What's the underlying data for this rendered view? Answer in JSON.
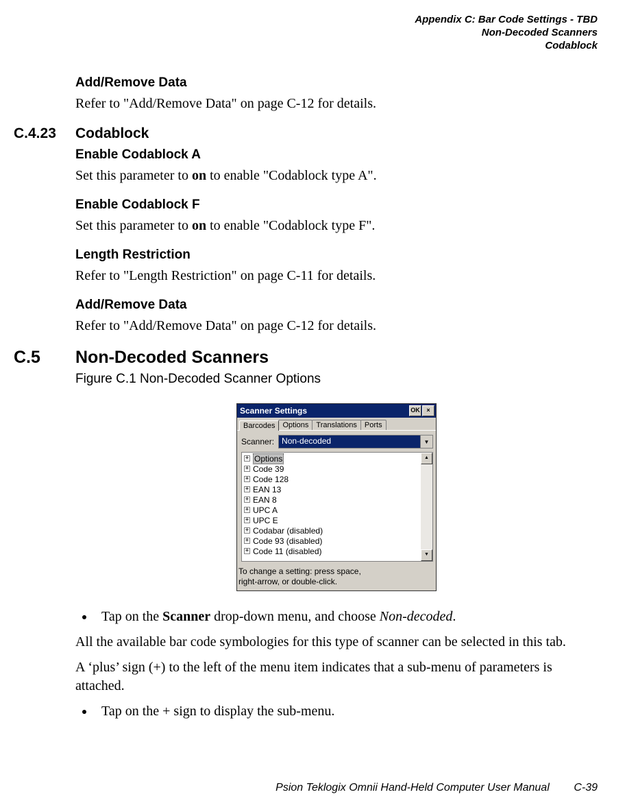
{
  "header": {
    "line1": "Appendix C:  Bar Code Settings - TBD",
    "line2": "Non-Decoded Scanners",
    "line3": "Codablock"
  },
  "sec_prev": {
    "add_remove_h": "Add/Remove Data",
    "add_remove_body": "Refer to \"Add/Remove Data\" on page C-12 for details."
  },
  "sec_c423": {
    "num": "C.4.23",
    "title": "Codablock",
    "enable_a_h": "Enable Codablock A",
    "enable_a_pre": "Set this parameter to ",
    "enable_a_bold": "on",
    "enable_a_post": " to enable \"Codablock type A\".",
    "enable_f_h": "Enable Codablock F",
    "enable_f_pre": "Set this parameter to ",
    "enable_f_bold": "on",
    "enable_f_post": " to enable \"Codablock type F\".",
    "length_h": "Length Restriction",
    "length_body": "Refer to \"Length Restriction\" on page C-11 for details.",
    "add_remove_h": "Add/Remove Data",
    "add_remove_body": "Refer to \"Add/Remove Data\" on page C-12 for details."
  },
  "sec_c5": {
    "num": "C.5",
    "title": "Non-Decoded Scanners",
    "fig": "Figure C.1  Non-Decoded Scanner Options"
  },
  "screenshot": {
    "title": "Scanner Settings",
    "ok": "OK",
    "close": "×",
    "tabs": [
      "Barcodes",
      "Options",
      "Translations",
      "Ports"
    ],
    "scanner_label": "Scanner:",
    "scanner_value": "Non-decoded",
    "tree": [
      "Options",
      "Code 39",
      "Code 128",
      "EAN 13",
      "EAN 8",
      "UPC A",
      "UPC E",
      "Codabar (disabled)",
      "Code 93 (disabled)",
      "Code 11 (disabled)"
    ],
    "scroll_up": "▲",
    "scroll_down": "▼",
    "combo_arrow": "▼",
    "hint_l1": "To change a setting: press space,",
    "hint_l2": "right-arrow, or double-click."
  },
  "after": {
    "bullet1_pre": "Tap on the ",
    "bullet1_bold": "Scanner",
    "bullet1_mid": " drop-down menu, and choose ",
    "bullet1_italic": "Non-decoded",
    "bullet1_post": ".",
    "p1": "All the available bar code symbologies for this type of scanner can be selected in this tab.",
    "p2": "A ‘plus’ sign (+) to the left of the menu item indicates that a sub-menu of parameters is attached.",
    "bullet2": "Tap on the + sign to display the sub-menu."
  },
  "footer": {
    "text": "Psion Teklogix Omnii Hand-Held Computer User Manual",
    "page": "C-39"
  }
}
